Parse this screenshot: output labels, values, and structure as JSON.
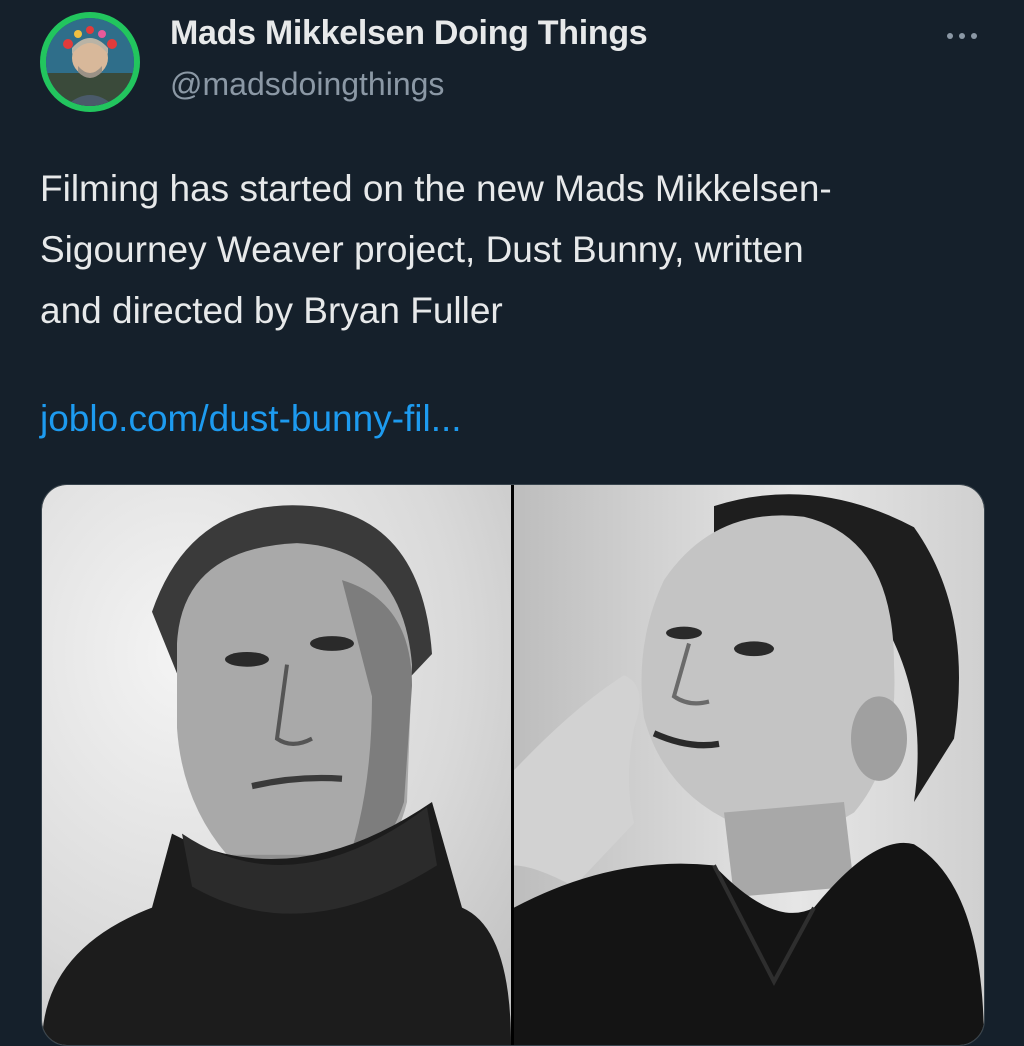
{
  "author": {
    "display_name": "Mads Mikkelsen Doing Things",
    "handle": "@madsdoingthings"
  },
  "tweet": {
    "text": "Filming has started on the new Mads Mikkelsen-\nSigourney Weaver project, Dust Bunny, written\nand directed by Bryan Fuller",
    "link": "joblo.com/dust-bunny-fil..."
  },
  "media": {
    "photos": [
      {
        "description": "black and white portrait, man in dark turtleneck"
      },
      {
        "description": "black and white portrait, woman with hand behind head"
      }
    ]
  },
  "colors": {
    "background": "#15202b",
    "text_primary": "#e7e9ea",
    "text_secondary": "#8b98a5",
    "link": "#1d9bf0",
    "avatar_ring": "#22c55e"
  },
  "icons": {
    "more": "more-options-icon"
  }
}
